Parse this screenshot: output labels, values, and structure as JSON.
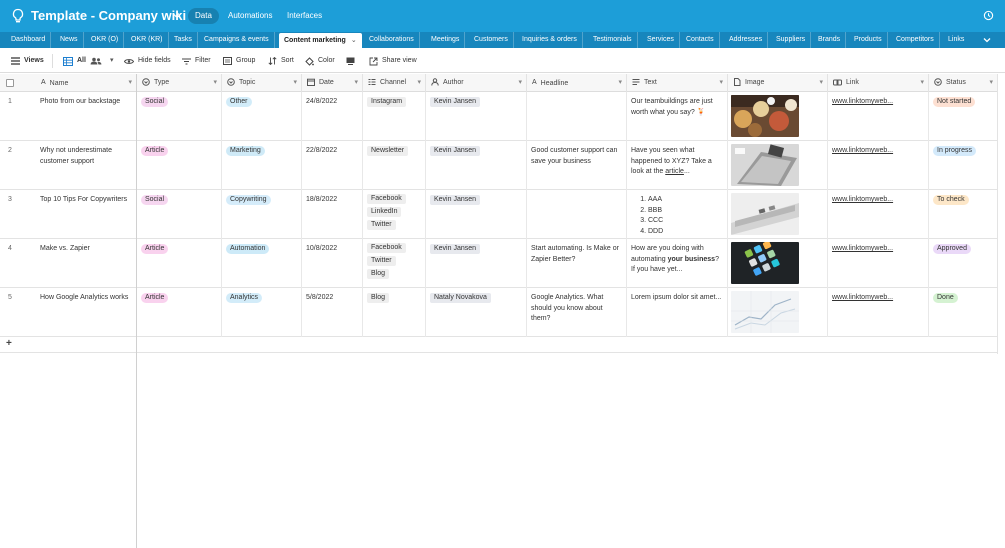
{
  "header": {
    "title": "Template - Company wiki",
    "nav": [
      "Data",
      "Automations",
      "Interfaces"
    ],
    "active_nav": "Data",
    "accent": "#1d9ed8"
  },
  "tabs": {
    "items": [
      "Dashboard",
      "News",
      "OKR (O)",
      "OKR (KR)",
      "Tasks",
      "Campaigns & events",
      "Content marketing",
      "Collaborations",
      "Meetings",
      "Customers",
      "Inquiries & orders",
      "Testimonials",
      "Services",
      "Contacts",
      "Addresses",
      "Suppliers",
      "Brands",
      "Products",
      "Competitors",
      "Links"
    ],
    "active": "Content marketing"
  },
  "toolbar": {
    "views": "Views",
    "view_name": "All",
    "hide_fields": "Hide fields",
    "filter": "Filter",
    "group": "Group",
    "sort": "Sort",
    "color": "Color",
    "share": "Share view"
  },
  "columns": [
    "Name",
    "Type",
    "Topic",
    "Date",
    "Channel",
    "Author",
    "Headline",
    "Text",
    "Image",
    "Link",
    "Status"
  ],
  "rows": [
    {
      "num": "1",
      "name": "Photo from our backstage",
      "type": "Social",
      "topic": "Other",
      "date": "24/8/2022",
      "channels": [
        "Instagram"
      ],
      "author": "Kevin Jansen",
      "headline": "",
      "text": "Our teambuildings are just worth what you say? 🍹",
      "image": "food-photo",
      "link": "www.linktomyweb...",
      "status": "Not started"
    },
    {
      "num": "2",
      "name": "Why not underestimate customer support",
      "type": "Article",
      "topic": "Marketing",
      "date": "22/8/2022",
      "channels": [
        "Newsletter"
      ],
      "author": "Kevin Jansen",
      "headline": "Good customer support can save your business",
      "text_pre": "Have you seen what happened to XYZ? Take a look at the ",
      "text_link": "article",
      "text_post": "...",
      "image": "laptop-photo",
      "link": "www.linktomyweb...",
      "status": "In progress"
    },
    {
      "num": "3",
      "name": "Top 10 Tips For Copywriters",
      "type": "Social",
      "topic": "Copywriting",
      "date": "18/8/2022",
      "channels": [
        "Facebook",
        "LinkedIn",
        "Twitter"
      ],
      "author": "Kevin Jansen",
      "headline": "",
      "list": [
        "AAA",
        "BBB",
        "CCC",
        "DDD"
      ],
      "image": "keyboard-photo",
      "link": "www.linktomyweb...",
      "status": "To check"
    },
    {
      "num": "4",
      "name": "Make vs. Zapier",
      "type": "Article",
      "topic": "Automation",
      "date": "10/8/2022",
      "channels": [
        "Facebook",
        "Twitter",
        "Blog"
      ],
      "author": "Kevin Jansen",
      "headline": "Start automating. Is Make or Zapier Better?",
      "text_pre": "How are you doing with automating ",
      "text_bold": "your business",
      "text_post": "? If you have yet...",
      "image": "phone-apps-photo",
      "link": "www.linktomyweb...",
      "status": "Approved"
    },
    {
      "num": "5",
      "name": "How Google Analytics works",
      "type": "Article",
      "topic": "Analytics",
      "date": "5/8/2022",
      "channels": [
        "Blog"
      ],
      "author": "Nataly Novakova",
      "headline": "Google Analytics. What should you know about them?",
      "text": "Lorem ipsum dolor sit amet...",
      "image": "chart-paper-photo",
      "link": "www.linktomyweb...",
      "status": "Done"
    }
  ],
  "add_row": "+",
  "colors": {
    "social": "#f6d6f0",
    "article": "#f9d2ee",
    "other": "#d2ecf9",
    "marketing": "#cfeaf7",
    "copywriting": "#d5ecfa",
    "automation": "#cdeaf8",
    "analytics": "#d3ecf9",
    "not_started": "#fde0d2",
    "in_progress": "#d4eafb",
    "to_check": "#fde7c8",
    "approved": "#ead9f8",
    "done": "#d5f2d2"
  }
}
